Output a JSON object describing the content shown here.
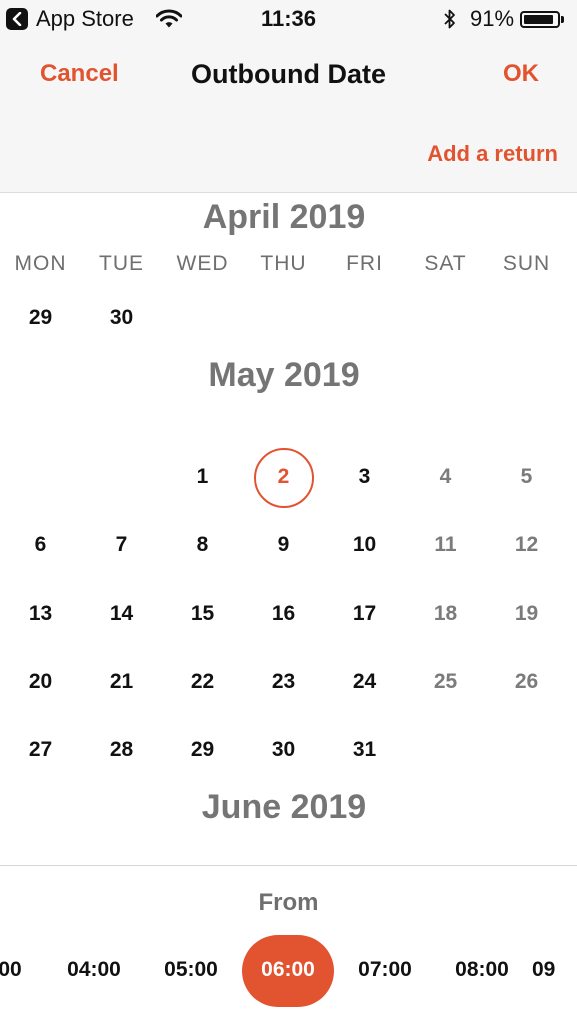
{
  "status_bar": {
    "back_app": "App Store",
    "time": "11:36",
    "battery_percent": "91%",
    "battery_level": 0.91,
    "icons": [
      "back-chevron-icon",
      "wifi-icon",
      "bluetooth-icon",
      "battery-icon"
    ]
  },
  "nav": {
    "cancel_label": "Cancel",
    "title": "Outbound Date",
    "ok_label": "OK",
    "add_return_label": "Add a return"
  },
  "calendar": {
    "weekdays": [
      "MON",
      "TUE",
      "WED",
      "THU",
      "FRI",
      "SAT",
      "SUN"
    ],
    "months": [
      {
        "title": "April 2019",
        "rows": [
          [
            "29",
            "30",
            "",
            "",
            "",
            "",
            ""
          ]
        ]
      },
      {
        "title": "May 2019",
        "rows": [
          [
            "",
            "",
            "1",
            "2",
            "3",
            "4",
            "5"
          ],
          [
            "6",
            "7",
            "8",
            "9",
            "10",
            "11",
            "12"
          ],
          [
            "13",
            "14",
            "15",
            "16",
            "17",
            "18",
            "19"
          ],
          [
            "20",
            "21",
            "22",
            "23",
            "24",
            "25",
            "26"
          ],
          [
            "27",
            "28",
            "29",
            "30",
            "31",
            "",
            ""
          ]
        ]
      },
      {
        "title": "June 2019",
        "rows": []
      }
    ],
    "selected_date": "2",
    "accent_color": "#e2532f"
  },
  "time_picker": {
    "label": "From",
    "options": [
      "00",
      "04:00",
      "05:00",
      "06:00",
      "07:00",
      "08:00",
      "09"
    ],
    "selected": "06:00"
  }
}
